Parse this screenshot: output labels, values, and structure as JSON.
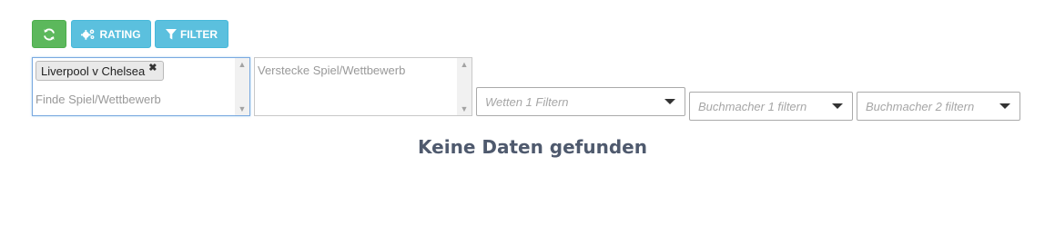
{
  "toolbar": {
    "refresh_icon": "refresh-icon",
    "rating_label": "RATING",
    "rating_icon": "cogs-icon",
    "filter_label": "FILTER",
    "filter_icon": "funnel-icon",
    "colors": {
      "success": "#5cb85c",
      "info": "#5bc0de"
    }
  },
  "show_matches": {
    "selected": [
      "Liverpool v Chelsea"
    ],
    "remove_glyph": "✖",
    "placeholder": "Finde Spiel/Wettbewerb"
  },
  "hide_matches": {
    "placeholder": "Verstecke Spiel/Wettbewerb"
  },
  "filters": {
    "bets_placeholder": "Wetten 1 Filtern",
    "bookmaker1_placeholder": "Buchmacher 1 filtern",
    "bookmaker2_placeholder": "Buchmacher 2 filtern"
  },
  "empty_message": "Keine Daten gefunden"
}
